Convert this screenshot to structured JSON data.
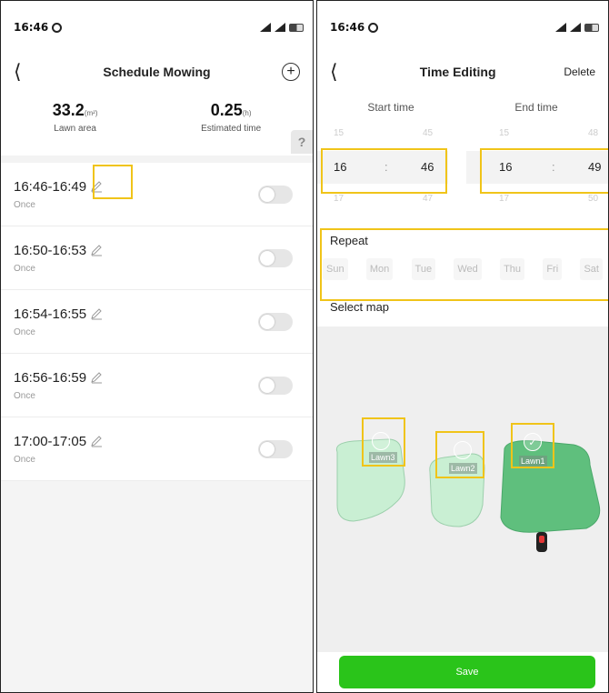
{
  "left": {
    "status": {
      "time": "16:46"
    },
    "nav": {
      "title": "Schedule Mowing"
    },
    "stats": {
      "area_value": "33.2",
      "area_unit": "(m²)",
      "area_label": "Lawn area",
      "time_value": "0.25",
      "time_unit": "(h)",
      "time_label": "Estimated time",
      "help": "?"
    },
    "schedules": [
      {
        "time": "16:46-16:49",
        "repeat": "Once",
        "enabled": false
      },
      {
        "time": "16:50-16:53",
        "repeat": "Once",
        "enabled": false
      },
      {
        "time": "16:54-16:55",
        "repeat": "Once",
        "enabled": false
      },
      {
        "time": "16:56-16:59",
        "repeat": "Once",
        "enabled": false
      },
      {
        "time": "17:00-17:05",
        "repeat": "Once",
        "enabled": false
      }
    ]
  },
  "right": {
    "status": {
      "time": "16:46"
    },
    "nav": {
      "title": "Time Editing",
      "delete": "Delete"
    },
    "start_label": "Start time",
    "end_label": "End time",
    "picker": {
      "start_hour": {
        "prev": "15",
        "sel": "16",
        "next": "17"
      },
      "start_min": {
        "prev": "45",
        "sel": "46",
        "next": "47"
      },
      "end_hour": {
        "prev": "15",
        "sel": "16",
        "next": "17"
      },
      "end_min": {
        "prev": "48",
        "sel": "49",
        "next": "50"
      },
      "sep": ":"
    },
    "repeat_label": "Repeat",
    "days": [
      "Sun",
      "Mon",
      "Tue",
      "Wed",
      "Thu",
      "Fri",
      "Sat"
    ],
    "map_label": "Select map",
    "lawns": [
      {
        "name": "Lawn3",
        "selected": false
      },
      {
        "name": "Lawn2",
        "selected": false
      },
      {
        "name": "Lawn1",
        "selected": true
      }
    ],
    "save": "Save"
  },
  "colors": {
    "accent": "#2ac41a",
    "highlight": "#f0c419",
    "lawn_light": "#c9efd3",
    "lawn_dark": "#5fbf7d"
  }
}
